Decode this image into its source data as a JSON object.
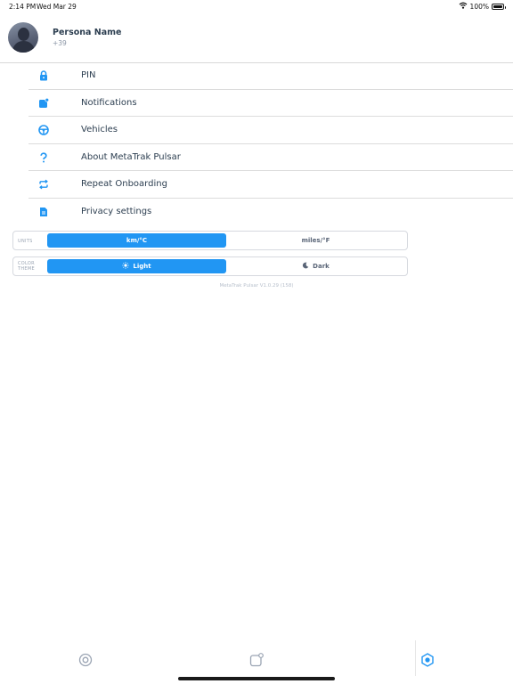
{
  "status_bar": {
    "time": "2:14 PM",
    "date": "Wed Mar 29",
    "battery": "100%"
  },
  "profile": {
    "name": "Persona Name",
    "phone": "+39"
  },
  "menu": {
    "items": [
      {
        "label": "PIN",
        "icon": "lock-icon"
      },
      {
        "label": "Notifications",
        "icon": "notification-icon"
      },
      {
        "label": "Vehicles",
        "icon": "steering-wheel-icon"
      },
      {
        "label": "About MetaTrak Pulsar",
        "icon": "question-icon"
      },
      {
        "label": "Repeat Onboarding",
        "icon": "repeat-icon"
      },
      {
        "label": "Privacy settings",
        "icon": "document-icon"
      }
    ]
  },
  "units": {
    "label_line1": "UNITS",
    "label_line2": "",
    "options": [
      "km/°C",
      "miles/°F"
    ],
    "selected": "km/°C"
  },
  "color_theme": {
    "label_line1": "COLOR",
    "label_line2": "THEME",
    "options": [
      "Light",
      "Dark"
    ],
    "selected": "Light"
  },
  "version": "MetaTrak Pulsar V1.0.29 (158)",
  "tabbar": {
    "tabs": [
      "target-icon",
      "notification-icon",
      "settings-hex-icon"
    ],
    "active": "settings-hex-icon"
  },
  "colors": {
    "accent": "#2196f3",
    "text": "#2c3e50",
    "muted": "#8a95a5"
  }
}
